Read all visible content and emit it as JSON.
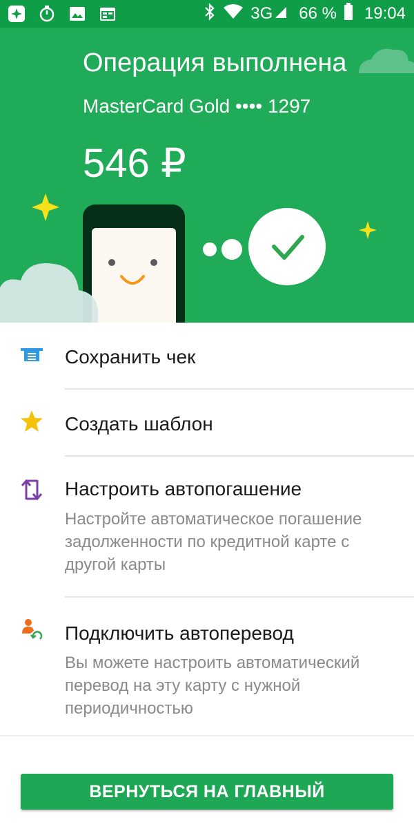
{
  "status_bar": {
    "network": "3G",
    "battery": "66 %",
    "time": "19:04",
    "icons": [
      "app-icon",
      "timer-icon",
      "image-icon",
      "calendar-icon",
      "bluetooth-icon",
      "wifi-icon",
      "signal-icon",
      "battery-icon"
    ]
  },
  "header": {
    "title": "Операция выполнена",
    "card": "MasterCard Gold •••• 1297",
    "amount": "546 ₽"
  },
  "actions": [
    {
      "label": "Сохранить чек",
      "icon": "receipt-icon",
      "color": "#2e9ae6"
    },
    {
      "label": "Создать шаблон",
      "icon": "star-icon",
      "color": "#f4c20d"
    },
    {
      "label": "Настроить автопогашение",
      "description": "Настройте автоматическое погашение задолженности по кредитной карте с другой карты",
      "icon": "transfer-arrows-icon",
      "color": "#7b3fa7"
    },
    {
      "label": "Подключить автоперевод",
      "description": "Вы можете настроить автоматический перевод на эту карту с нужной периодичностью",
      "icon": "person-cycle-icon",
      "color": "#ef6c1a"
    }
  ],
  "primary_button": {
    "label": "ВЕРНУТЬСЯ НА ГЛАВНЫЙ"
  },
  "colors": {
    "status_bar": "#0f9d47",
    "hero": "#1fab58",
    "button": "#1ea755"
  }
}
